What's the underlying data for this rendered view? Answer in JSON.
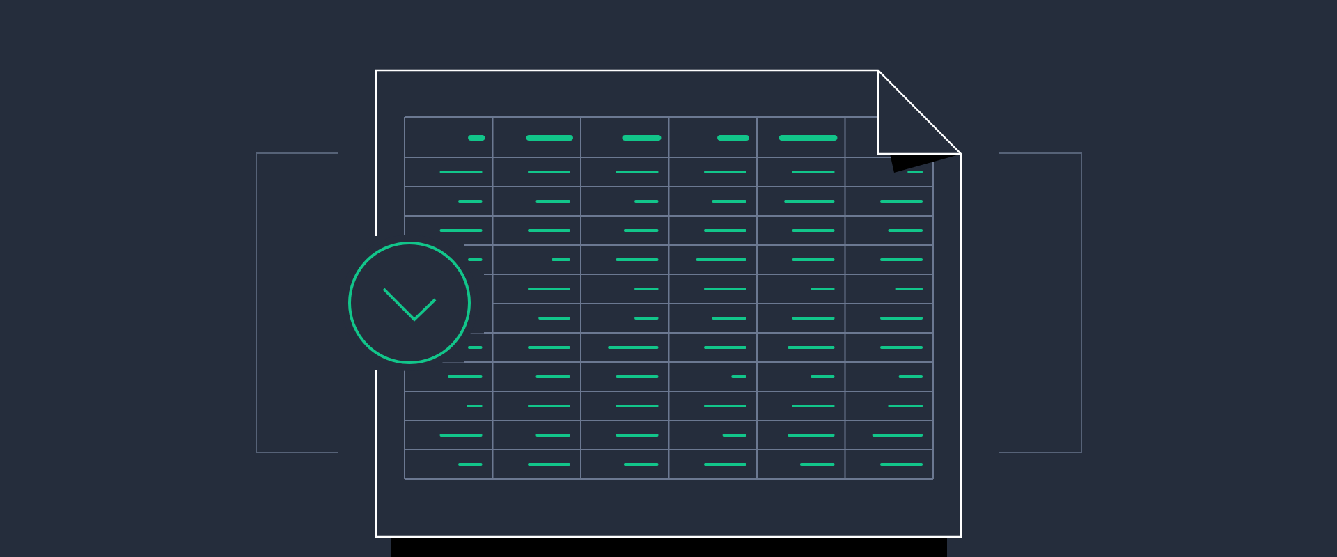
{
  "colors": {
    "background": "#252d3c",
    "document_outline": "#ffffff",
    "table_grid": "#6b7891",
    "bracket": "#566277",
    "accent": "#12c58a",
    "shadow": "#000000"
  },
  "illustration": {
    "kind": "spreadsheet document with checkmark badge",
    "icons": [
      "document-icon",
      "folded-corner-icon",
      "check-circle-icon",
      "checkmark-icon",
      "left-bracket",
      "right-bracket"
    ]
  },
  "table": {
    "columns": 6,
    "rows": 12,
    "header_fill": [
      0.13,
      0.47,
      0.38,
      0.3,
      0.6,
      0.0
    ],
    "row_fill": [
      [
        0.45,
        0.45,
        0.45,
        0.45,
        0.45,
        0.14
      ],
      [
        0.24,
        0.36,
        0.24,
        0.36,
        0.54,
        0.45
      ],
      [
        0.45,
        0.45,
        0.36,
        0.45,
        0.45,
        0.36
      ],
      [
        0.13,
        0.18,
        0.45,
        0.54,
        0.45,
        0.45
      ],
      [
        0.0,
        0.45,
        0.24,
        0.45,
        0.24,
        0.28
      ],
      [
        0.0,
        0.33,
        0.24,
        0.36,
        0.45,
        0.45
      ],
      [
        0.13,
        0.45,
        0.54,
        0.45,
        0.5,
        0.45
      ],
      [
        0.36,
        0.36,
        0.45,
        0.14,
        0.24,
        0.24
      ],
      [
        0.14,
        0.45,
        0.45,
        0.45,
        0.45,
        0.36
      ],
      [
        0.45,
        0.36,
        0.45,
        0.24,
        0.5,
        0.54
      ],
      [
        0.24,
        0.45,
        0.36,
        0.45,
        0.36,
        0.45
      ]
    ]
  }
}
